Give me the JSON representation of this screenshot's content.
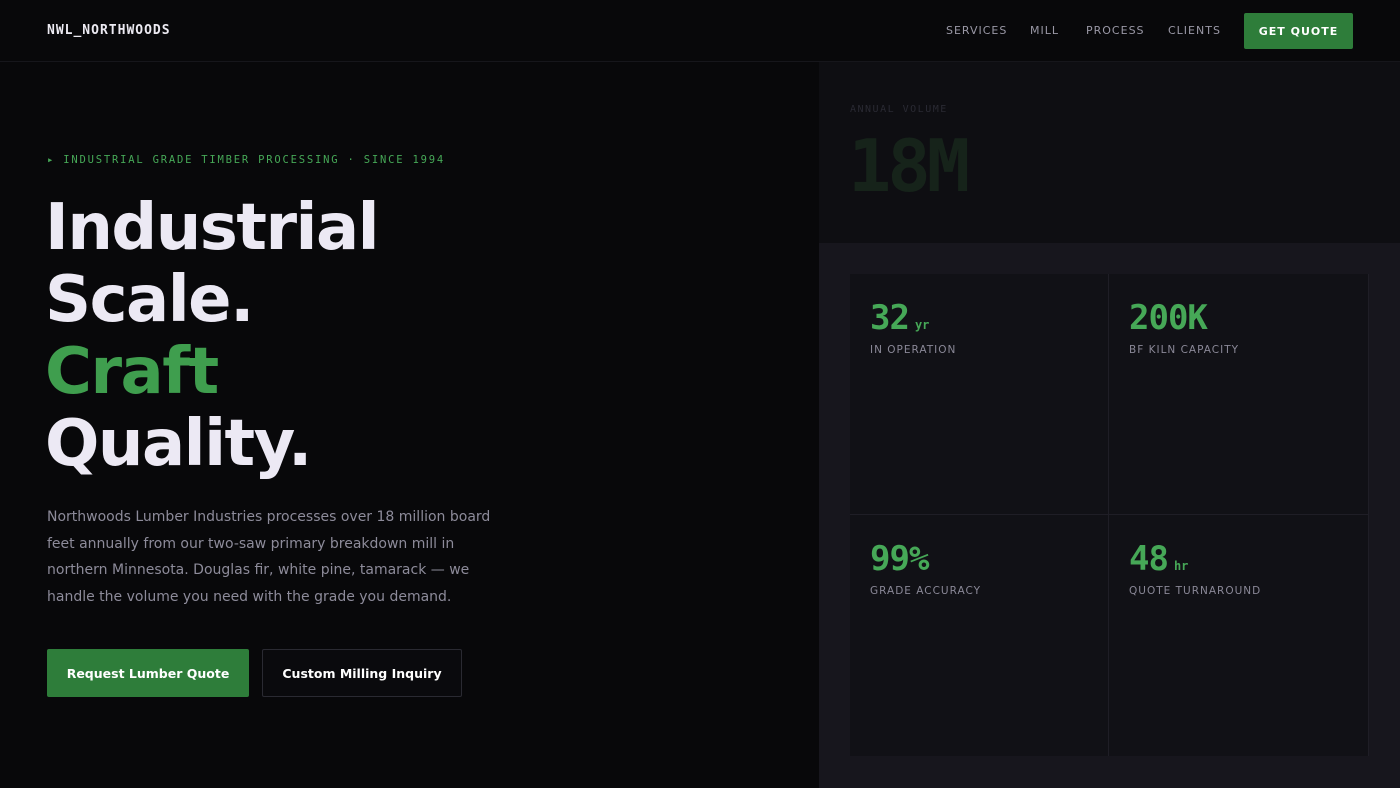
{
  "nav": {
    "logo": "NWL_NORTHWOODS",
    "links": [
      "SERVICES",
      "MILL",
      "PROCESS",
      "CLIENTS"
    ],
    "cta": "GET QUOTE"
  },
  "hero": {
    "eyebrow": "▸ INDUSTRIAL GRADE TIMBER PROCESSING · SINCE 1994",
    "headline": [
      "Industrial",
      "Scale.",
      "Craft",
      "Quality."
    ],
    "description": "Northwoods Lumber Industries processes over 18 million board feet annually from our two-saw primary breakdown mill in northern Minnesota. Douglas fir, white pine, tamarack — we handle the volume you need with the grade you demand.",
    "primary_button": "Request Lumber Quote",
    "secondary_button": "Custom Milling Inquiry"
  },
  "panel": {
    "volume_label": "ANNUAL VOLUME",
    "volume_value": "18M",
    "stats": [
      {
        "value": "32",
        "unit": "yr",
        "label": "IN OPERATION"
      },
      {
        "value": "200K",
        "unit": "",
        "label": "BF KILN CAPACITY"
      },
      {
        "value": "99%",
        "unit": "",
        "label": "GRADE ACCURACY"
      },
      {
        "value": "48",
        "unit": "hr",
        "label": "QUOTE TURNAROUND"
      }
    ]
  },
  "colors": {
    "accent": "#2e7d3a",
    "accent_text": "#46a857",
    "background": "#08080a",
    "panel": "#17161d"
  }
}
